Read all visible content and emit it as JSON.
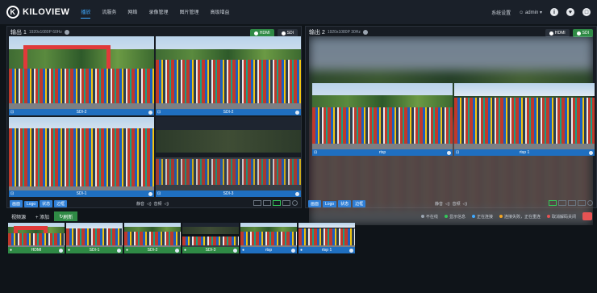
{
  "brand": {
    "name": "KILOVIEW"
  },
  "nav": {
    "items": [
      "播放",
      "流服务",
      "网络",
      "录像管理",
      "图片管理",
      "高级增益"
    ]
  },
  "topbar": {
    "settings": "系统设置",
    "user": "admin"
  },
  "output1": {
    "title": "输出 1",
    "spec": "1920x1080P 60Hz",
    "btn_hdmi": "HDMI",
    "btn_sdi": "SDI",
    "tiles": [
      "SDI-2",
      "SDI-2",
      "SDI-1",
      "SDI-3"
    ],
    "tools": [
      "画面",
      "Logo",
      "状态",
      "边框"
    ],
    "vol": "静音",
    "audio": "音频"
  },
  "output2": {
    "title": "输出 2",
    "spec": "1920x1080P 30Hz",
    "btn_hdmi": "HDMI",
    "btn_sdi": "SDI",
    "tiles": [
      "rtsp",
      "rtsp 1"
    ],
    "tools": [
      "画面",
      "Logo",
      "状态",
      "边框"
    ],
    "vol": "静音",
    "audio": "音频"
  },
  "source_bar": {
    "tab_sources": "视频源",
    "add": "+ 添加",
    "refresh": "刷新",
    "legend": [
      {
        "label": "不在线",
        "color": "#9aa4b0"
      },
      {
        "label": "显示信息",
        "color": "#34c759"
      },
      {
        "label": "正在连接",
        "color": "#3fa9ff"
      },
      {
        "label": "连接失败，正在重连",
        "color": "#f5a623"
      },
      {
        "label": "取消解码关闭",
        "color": "#e55353"
      }
    ]
  },
  "thumbnails": [
    {
      "label": "HDMI",
      "active": false
    },
    {
      "label": "SDI-1",
      "active": false
    },
    {
      "label": "SDI-2",
      "active": false
    },
    {
      "label": "SDI-3",
      "active": false
    },
    {
      "label": "rtsp",
      "active": true
    },
    {
      "label": "rtsp 1",
      "active": true
    }
  ]
}
